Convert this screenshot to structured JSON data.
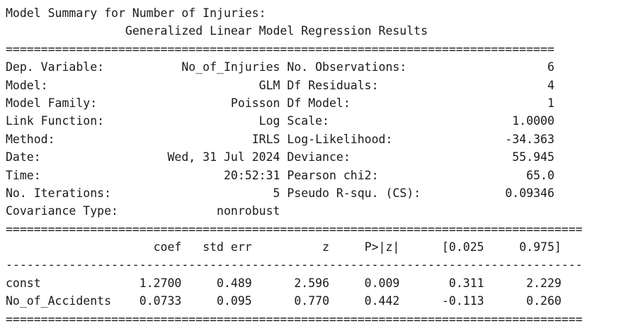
{
  "heading": "Model Summary for Number of Injuries:",
  "title": "Generalized Linear Model Regression Results",
  "model_info": [
    {
      "label_left": "Dep. Variable:",
      "value_left": "No_of_Injuries",
      "label_right": "No. Observations:",
      "value_right": "6"
    },
    {
      "label_left": "Model:",
      "value_left": "GLM",
      "label_right": "Df Residuals:",
      "value_right": "4"
    },
    {
      "label_left": "Model Family:",
      "value_left": "Poisson",
      "label_right": "Df Model:",
      "value_right": "1"
    },
    {
      "label_left": "Link Function:",
      "value_left": "Log",
      "label_right": "Scale:",
      "value_right": "1.0000"
    },
    {
      "label_left": "Method:",
      "value_left": "IRLS",
      "label_right": "Log-Likelihood:",
      "value_right": "-34.363"
    },
    {
      "label_left": "Date:",
      "value_left": "Wed, 31 Jul 2024",
      "label_right": "Deviance:",
      "value_right": "55.945"
    },
    {
      "label_left": "Time:",
      "value_left": "20:52:31",
      "label_right": "Pearson chi2:",
      "value_right": "65.0"
    },
    {
      "label_left": "No. Iterations:",
      "value_left": "5",
      "label_right": "Pseudo R-squ. (CS):",
      "value_right": "0.09346"
    },
    {
      "label_left": "Covariance Type:",
      "value_left": "nonrobust",
      "label_right": "",
      "value_right": ""
    }
  ],
  "coef_table": {
    "columns": [
      "coef",
      "std err",
      "z",
      "P>|z|",
      "[0.025",
      "0.975]"
    ],
    "rows": [
      {
        "name": "const",
        "values": [
          "1.2700",
          "0.489",
          "2.596",
          "0.009",
          "0.311",
          "2.229"
        ]
      },
      {
        "name": "No_of_Accidents",
        "values": [
          "0.0733",
          "0.095",
          "0.770",
          "0.442",
          "-0.113",
          "0.260"
        ]
      }
    ]
  }
}
